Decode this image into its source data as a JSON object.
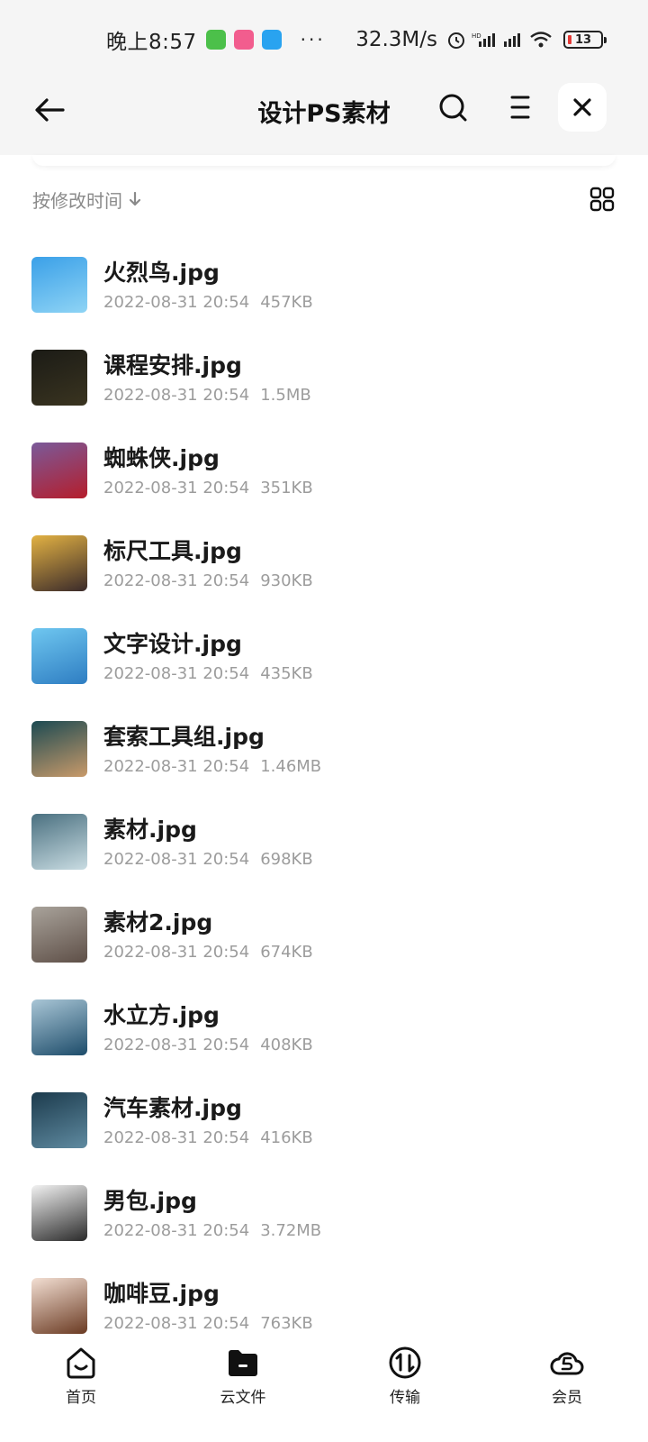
{
  "status_bar": {
    "time": "晚上8:57",
    "speed": "32.3M/s",
    "battery": "13",
    "icons": [
      "download-app-icon",
      "bilibili-app-icon",
      "browser-app-icon",
      "more-dots-icon",
      "alarm-icon",
      "hd-signal-icon",
      "signal-icon",
      "wifi-icon",
      "battery-icon"
    ]
  },
  "header": {
    "title": "设计PS素材",
    "icons": [
      "back-arrow-icon",
      "search-icon",
      "menu-icon",
      "close-icon"
    ]
  },
  "sort": {
    "label": "按修改时间",
    "icons": [
      "sort-down-arrow-icon",
      "grid-view-icon"
    ]
  },
  "files": [
    {
      "name": "火烈鸟.jpg",
      "date": "2022-08-31 20:54",
      "size": "457KB",
      "thumb_colors": [
        "#3aa0e8",
        "#8fd4f5"
      ]
    },
    {
      "name": "课程安排.jpg",
      "date": "2022-08-31 20:54",
      "size": "1.5MB",
      "thumb_colors": [
        "#1b1b16",
        "#3a3420"
      ]
    },
    {
      "name": "蜘蛛侠.jpg",
      "date": "2022-08-31 20:54",
      "size": "351KB",
      "thumb_colors": [
        "#7a5a9a",
        "#b51d2b"
      ]
    },
    {
      "name": "标尺工具.jpg",
      "date": "2022-08-31 20:54",
      "size": "930KB",
      "thumb_colors": [
        "#e3b243",
        "#3a2a2a"
      ]
    },
    {
      "name": "文字设计.jpg",
      "date": "2022-08-31 20:54",
      "size": "435KB",
      "thumb_colors": [
        "#6fc7f0",
        "#2e7dc2"
      ]
    },
    {
      "name": "套索工具组.jpg",
      "date": "2022-08-31 20:54",
      "size": "1.46MB",
      "thumb_colors": [
        "#1c4a52",
        "#c99a6a"
      ]
    },
    {
      "name": "素材.jpg",
      "date": "2022-08-31 20:54",
      "size": "698KB",
      "thumb_colors": [
        "#4a7080",
        "#c9dce2"
      ]
    },
    {
      "name": "素材2.jpg",
      "date": "2022-08-31 20:54",
      "size": "674KB",
      "thumb_colors": [
        "#a9a39b",
        "#5e4f47"
      ]
    },
    {
      "name": "水立方.jpg",
      "date": "2022-08-31 20:54",
      "size": "408KB",
      "thumb_colors": [
        "#a9c6d6",
        "#1d4c6a"
      ]
    },
    {
      "name": "汽车素材.jpg",
      "date": "2022-08-31 20:54",
      "size": "416KB",
      "thumb_colors": [
        "#1c3b4d",
        "#5f8aa0"
      ]
    },
    {
      "name": "男包.jpg",
      "date": "2022-08-31 20:54",
      "size": "3.72MB",
      "thumb_colors": [
        "#f2f2f2",
        "#2a2a2a"
      ]
    },
    {
      "name": "咖啡豆.jpg",
      "date": "2022-08-31 20:54",
      "size": "763KB",
      "thumb_colors": [
        "#f3dfd3",
        "#6a3a22"
      ]
    }
  ],
  "bottom_nav": [
    {
      "label": "首页",
      "icon": "home-icon"
    },
    {
      "label": "云文件",
      "icon": "folder-icon"
    },
    {
      "label": "传输",
      "icon": "transfer-icon"
    },
    {
      "label": "会员",
      "icon": "vip-cloud-icon"
    }
  ]
}
